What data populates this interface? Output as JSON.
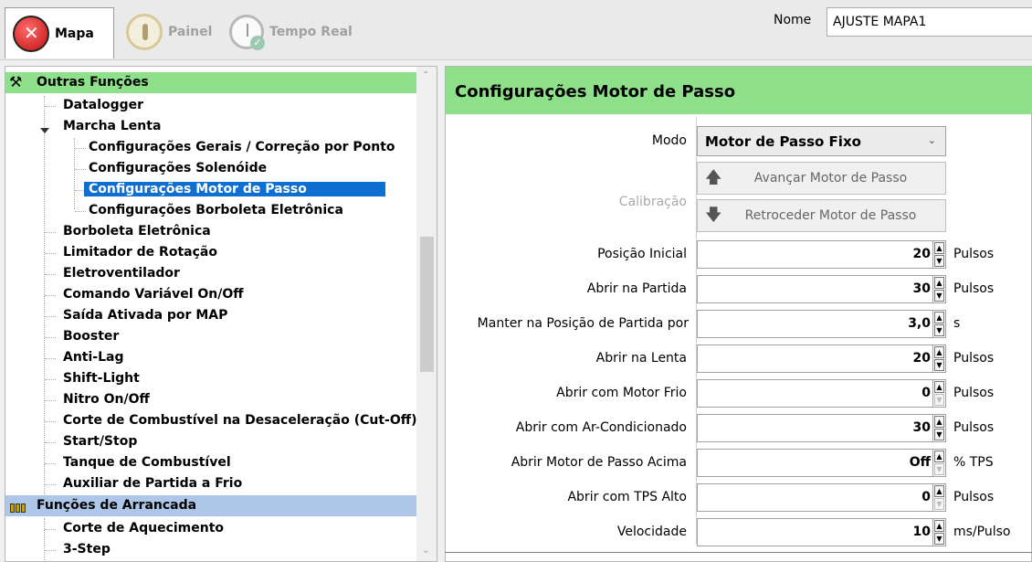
{
  "toolbar": {
    "tabs": [
      {
        "label": "Mapa",
        "icon": "map-icon",
        "active": true
      },
      {
        "label": "Painel",
        "icon": "gauge-icon",
        "active": false
      },
      {
        "label": "Tempo Real",
        "icon": "clock-icon",
        "active": false
      }
    ],
    "nome_label": "Nome",
    "nome_value": "AJUSTE MAPA1"
  },
  "tree": {
    "groups": [
      {
        "label": "Outras Funções",
        "icon": "tools-icon"
      },
      {
        "label": "Funções de Arrancada",
        "icon": "drag-race-icon"
      }
    ],
    "items": [
      "Datalogger",
      "Marcha Lenta",
      "Configurações Gerais / Correção por Ponto",
      "Configurações Solenóide",
      "Configurações Motor de Passo",
      "Configurações Borboleta Eletrônica",
      "Borboleta Eletrônica",
      "Limitador de Rotação",
      "Eletroventilador",
      "Comando Variável On/Off",
      "Saída Ativada por MAP",
      "Booster",
      "Anti-Lag",
      "Shift-Light",
      "Nitro On/Off",
      "Corte de Combustível na Desaceleração (Cut-Off)",
      "Start/Stop",
      "Tanque de Combustível",
      "Auxiliar de Partida a Frio",
      "Corte de Aquecimento",
      "3-Step"
    ],
    "selected": "Configurações Motor de Passo"
  },
  "panel": {
    "title": "Configurações Motor de Passo",
    "modo_label": "Modo",
    "modo_value": "Motor de Passo Fixo",
    "calibracao_label": "Calibração",
    "btn_avancar": "Avançar Motor de Passo",
    "btn_retroceder": "Retroceder Motor de Passo",
    "fields": [
      {
        "label": "Posição Inicial",
        "value": "20",
        "unit": "Pulsos"
      },
      {
        "label": "Abrir na Partida",
        "value": "30",
        "unit": "Pulsos"
      },
      {
        "label": "Manter na Posição de Partida por",
        "value": "3,0",
        "unit": "s"
      },
      {
        "label": "Abrir na Lenta",
        "value": "20",
        "unit": "Pulsos"
      },
      {
        "label": "Abrir com Motor Frio",
        "value": "0",
        "unit": "Pulsos"
      },
      {
        "label": "Abrir com Ar-Condicionado",
        "value": "30",
        "unit": "Pulsos"
      },
      {
        "label": "Abrir Motor de Passo Acima",
        "value": "Off",
        "unit": "% TPS"
      },
      {
        "label": "Abrir com TPS Alto",
        "value": "0",
        "unit": "Pulsos"
      },
      {
        "label": "Velocidade",
        "value": "10",
        "unit": "ms/Pulso"
      }
    ]
  }
}
